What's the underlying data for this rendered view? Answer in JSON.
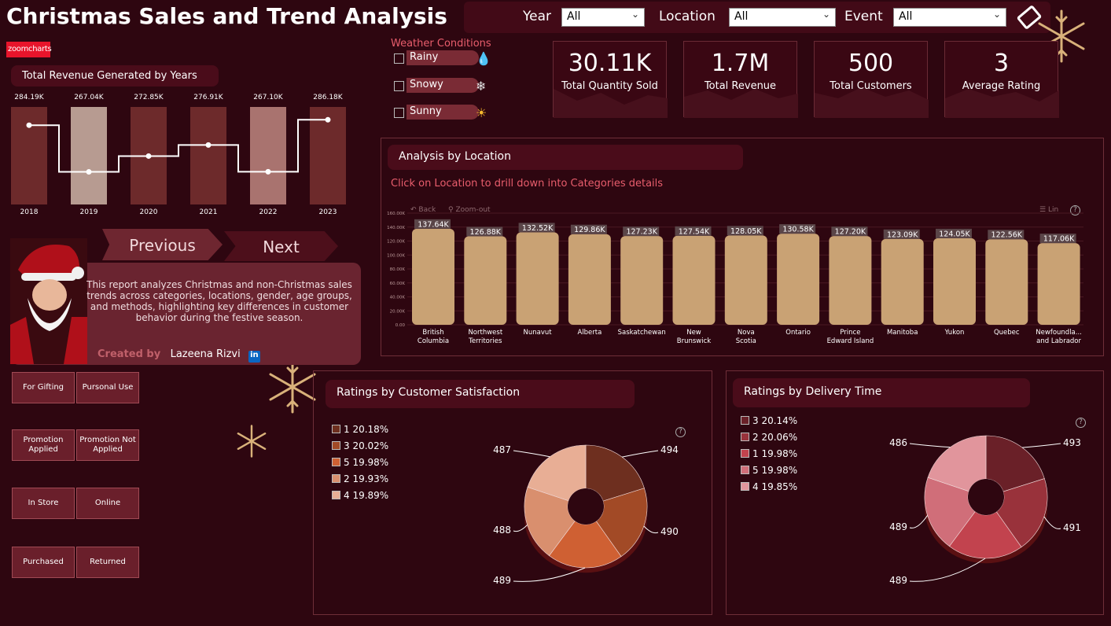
{
  "title": "Christmas Sales and Trend Analysis",
  "filters": [
    {
      "label": "Year",
      "value": "All"
    },
    {
      "label": "Location",
      "value": "All"
    },
    {
      "label": "Event",
      "value": "All"
    }
  ],
  "zoomcharts_logo": "zoomcharts",
  "weather": {
    "title": "Weather Conditions",
    "options": [
      {
        "label": "Rainy",
        "icon": "droplet-icon"
      },
      {
        "label": "Snowy",
        "icon": "snowflake-icon"
      },
      {
        "label": "Sunny",
        "icon": "sun-icon"
      }
    ]
  },
  "kpis": [
    {
      "value": "30.11K",
      "label": "Total Quantity Sold"
    },
    {
      "value": "1.7M",
      "label": "Total Revenue"
    },
    {
      "value": "500",
      "label": "Total Customers"
    },
    {
      "value": "3",
      "label": "Average Rating"
    }
  ],
  "revenue_panel": {
    "title": "Total Revenue Generated by Years"
  },
  "navigation": {
    "previous": "Previous",
    "next": "Next"
  },
  "info": {
    "text": "This report analyzes Christmas and non-Christmas sales trends across categories, locations, gender, age groups, and methods, highlighting key differences in customer behavior during the festive season.",
    "created_by": "Created by",
    "author": "Lazeena Rizvi",
    "linkedin": "in"
  },
  "segments": [
    [
      "For Gifting",
      "Pursonal Use"
    ],
    [
      "Promotion Applied",
      "Promotion Not Applied"
    ],
    [
      "In Store",
      "Online"
    ],
    [
      "Purchased",
      "Returned"
    ]
  ],
  "location_panel": {
    "title": "Analysis by Location",
    "hint": "Click on Location to drill down into Categories details",
    "back": "Back",
    "zoom_out": "Zoom-out",
    "lin": "Lin"
  },
  "satisfaction_panel": {
    "title": "Ratings by Customer Satisfaction"
  },
  "delivery_panel": {
    "title": "Ratings by Delivery Time"
  },
  "colors": {
    "background": "#2e0610",
    "bar_location": "#c9a274",
    "accent_red": "#e85d6c"
  },
  "chart_data": [
    {
      "type": "bar",
      "title": "Total Revenue Generated by Years",
      "categories": [
        "2018",
        "2019",
        "2020",
        "2021",
        "2022",
        "2023"
      ],
      "values": [
        284.19,
        267.04,
        272.85,
        276.91,
        267.1,
        286.18
      ],
      "data_labels": [
        "284.19K",
        "267.04K",
        "272.85K",
        "276.91K",
        "267.10K",
        "286.18K"
      ],
      "bar_colors": [
        "#6d2a2b",
        "#b79b91",
        "#6d2a2b",
        "#6d2a2b",
        "#a9736f",
        "#6d2a2b"
      ],
      "overlay": "step-line"
    },
    {
      "type": "bar",
      "title": "Analysis by Location",
      "categories": [
        "British Columbia",
        "Northwest Territories",
        "Nunavut",
        "Alberta",
        "Saskatchewan",
        "New Brunswick",
        "Nova Scotia",
        "Ontario",
        "Prince Edward Island",
        "Manitoba",
        "Yukon",
        "Quebec",
        "Newfoundla... and Labrador"
      ],
      "values": [
        137.64,
        126.88,
        132.52,
        129.86,
        127.23,
        127.54,
        128.05,
        130.58,
        127.2,
        123.09,
        124.05,
        122.56,
        117.06
      ],
      "data_labels": [
        "137.64K",
        "126.88K",
        "132.52K",
        "129.86K",
        "127.23K",
        "127.54K",
        "128.05K",
        "130.58K",
        "127.20K",
        "123.09K",
        "124.05K",
        "122.56K",
        "117.06K"
      ],
      "y_ticks": [
        "0.00",
        "20.00K",
        "40.00K",
        "60.00K",
        "80.00K",
        "100.00K",
        "120.00K",
        "140.00K",
        "160.00K"
      ],
      "ylim": [
        0,
        160
      ]
    },
    {
      "type": "pie",
      "title": "Ratings by Customer Satisfaction",
      "legend": [
        {
          "label": "1",
          "pct": "20.18%",
          "color": "#6e2f1f"
        },
        {
          "label": "3",
          "pct": "20.02%",
          "color": "#a24a26"
        },
        {
          "label": "5",
          "pct": "19.98%",
          "color": "#cf6033"
        },
        {
          "label": "2",
          "pct": "19.93%",
          "color": "#d98f6e"
        },
        {
          "label": "4",
          "pct": "19.89%",
          "color": "#e8ae95"
        }
      ],
      "values": [
        494,
        490,
        489,
        488,
        487
      ]
    },
    {
      "type": "pie",
      "title": "Ratings by Delivery Time",
      "legend": [
        {
          "label": "3",
          "pct": "20.14%",
          "color": "#6a2028"
        },
        {
          "label": "2",
          "pct": "20.06%",
          "color": "#99323b"
        },
        {
          "label": "1",
          "pct": "19.98%",
          "color": "#c2434e"
        },
        {
          "label": "5",
          "pct": "19.98%",
          "color": "#d06e79"
        },
        {
          "label": "4",
          "pct": "19.85%",
          "color": "#e1959c"
        }
      ],
      "values": [
        493,
        491,
        489,
        489,
        486
      ]
    }
  ]
}
